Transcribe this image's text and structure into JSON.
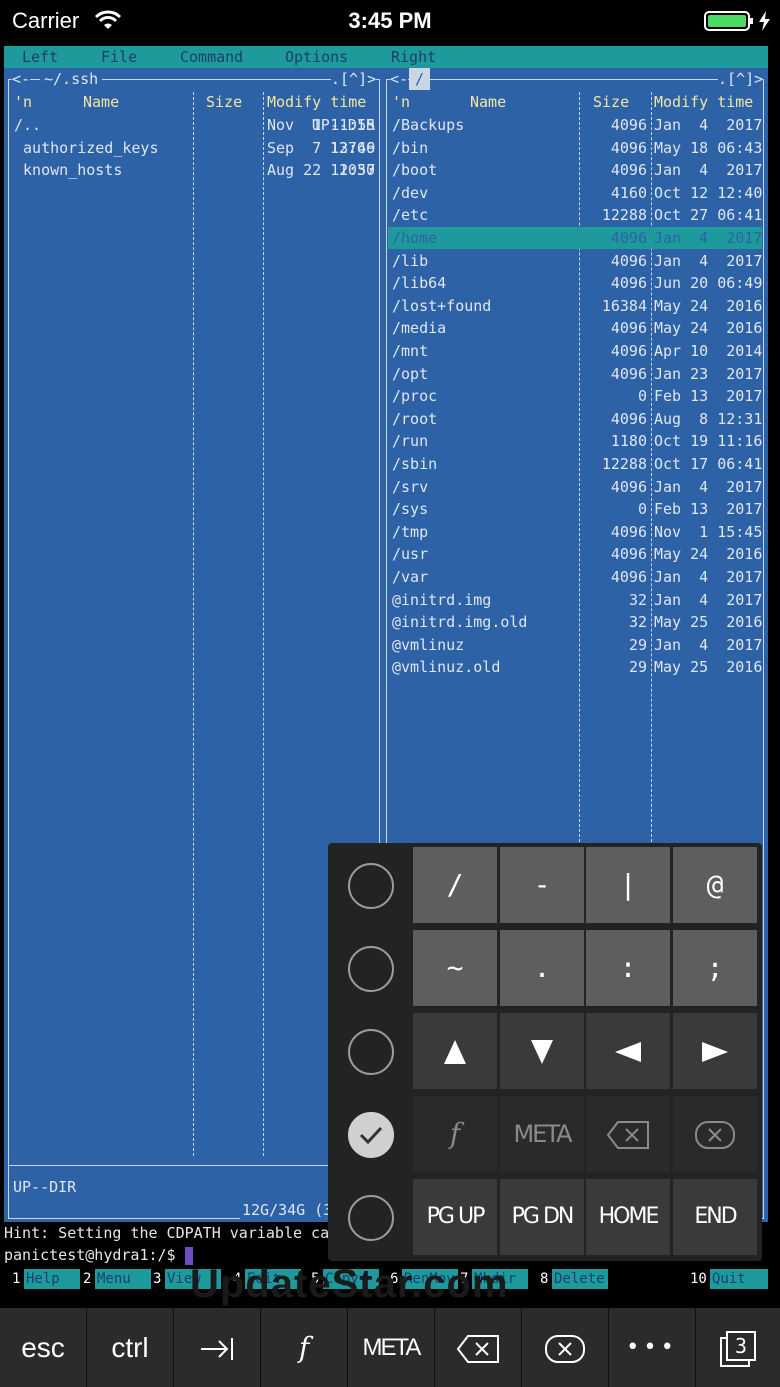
{
  "status_bar": {
    "carrier": "Carrier",
    "time": "3:45 PM"
  },
  "menu": {
    "left": "Left",
    "file": "File",
    "command": "Command",
    "options": "Options",
    "right": "Right"
  },
  "left_panel": {
    "path": "~/.ssh",
    "corner": ".[^]>",
    "corner_left": "<-",
    "headers": {
      "n": "'n",
      "name": "Name",
      "size": "Size",
      "mtime": "Modify time"
    },
    "rows": [
      {
        "name": "/..",
        "size": "UP--DIR",
        "date": "Nov  1 11:55"
      },
      {
        "name": " authorized_keys",
        "size": "12766",
        "date": "Sep  7 13:49"
      },
      {
        "name": " known_hosts",
        "size": "1030",
        "date": "Aug 22 12:57"
      }
    ],
    "mini_status": "UP--DIR",
    "disk": "12G/34G (3"
  },
  "right_panel": {
    "path": "/",
    "corner": ".[^]>",
    "corner_left": "<-",
    "headers": {
      "n": "'n",
      "name": "Name",
      "size": "Size",
      "mtime": "Modify time"
    },
    "rows": [
      {
        "name": "/Backups",
        "size": "4096",
        "date": "Jan  4  2017"
      },
      {
        "name": "/bin",
        "size": "4096",
        "date": "May 18 06:43"
      },
      {
        "name": "/boot",
        "size": "4096",
        "date": "Jan  4  2017"
      },
      {
        "name": "/dev",
        "size": "4160",
        "date": "Oct 12 12:40"
      },
      {
        "name": "/etc",
        "size": "12288",
        "date": "Oct 27 06:41"
      },
      {
        "name": "/home",
        "size": "4096",
        "date": "Jan  4  2017"
      },
      {
        "name": "/lib",
        "size": "4096",
        "date": "Jan  4  2017"
      },
      {
        "name": "/lib64",
        "size": "4096",
        "date": "Jun 20 06:49"
      },
      {
        "name": "/lost+found",
        "size": "16384",
        "date": "May 24  2016"
      },
      {
        "name": "/media",
        "size": "4096",
        "date": "May 24  2016"
      },
      {
        "name": "/mnt",
        "size": "4096",
        "date": "Apr 10  2014"
      },
      {
        "name": "/opt",
        "size": "4096",
        "date": "Jan 23  2017"
      },
      {
        "name": "/proc",
        "size": "0",
        "date": "Feb 13  2017"
      },
      {
        "name": "/root",
        "size": "4096",
        "date": "Aug  8 12:31"
      },
      {
        "name": "/run",
        "size": "1180",
        "date": "Oct 19 11:16"
      },
      {
        "name": "/sbin",
        "size": "12288",
        "date": "Oct 17 06:41"
      },
      {
        "name": "/srv",
        "size": "4096",
        "date": "Jan  4  2017"
      },
      {
        "name": "/sys",
        "size": "0",
        "date": "Feb 13  2017"
      },
      {
        "name": "/tmp",
        "size": "4096",
        "date": "Nov  1 15:45"
      },
      {
        "name": "/usr",
        "size": "4096",
        "date": "May 24  2016"
      },
      {
        "name": "/var",
        "size": "4096",
        "date": "Jan  4  2017"
      },
      {
        "name": "@initrd.img",
        "size": "32",
        "date": "Jan  4  2017"
      },
      {
        "name": "@initrd.img.old",
        "size": "32",
        "date": "May 25  2016"
      },
      {
        "name": "@vmlinuz",
        "size": "29",
        "date": "Jan  4  2017"
      },
      {
        "name": "@vmlinuz.old",
        "size": "29",
        "date": "May 25  2016"
      }
    ],
    "selected": "/home"
  },
  "hint": "Hint: Setting the CDPATH variable can",
  "prompt": "panictest@hydra1:/$",
  "fkeys": [
    {
      "n": "1",
      "label": "Help"
    },
    {
      "n": "2",
      "label": "Menu"
    },
    {
      "n": "3",
      "label": "View"
    },
    {
      "n": "4",
      "label": "Edit"
    },
    {
      "n": "5",
      "label": "Copy"
    },
    {
      "n": "6",
      "label": "RenMov"
    },
    {
      "n": "7",
      "label": "Mkdir"
    },
    {
      "n": "8",
      "label": "Delete"
    },
    {
      "n": "10",
      "label": "Quit"
    }
  ],
  "keyboard": {
    "row1": [
      "/",
      "-",
      "|",
      "@"
    ],
    "row2": [
      "~",
      ".",
      ":",
      ";"
    ],
    "row3_icons": [
      "arrow-up-icon",
      "arrow-down-icon",
      "arrow-left-icon",
      "arrow-right-icon"
    ],
    "row4": {
      "f": "𝑓",
      "meta": "META"
    },
    "row5": [
      "PG UP",
      "PG DN",
      "HOME",
      "END"
    ],
    "selected_row": 4
  },
  "toolbar": {
    "esc": "esc",
    "ctrl": "ctrl",
    "f": "𝑓",
    "meta": "META",
    "more": "•••",
    "sessions": "3"
  },
  "watermark": "UpdateStar.com"
}
